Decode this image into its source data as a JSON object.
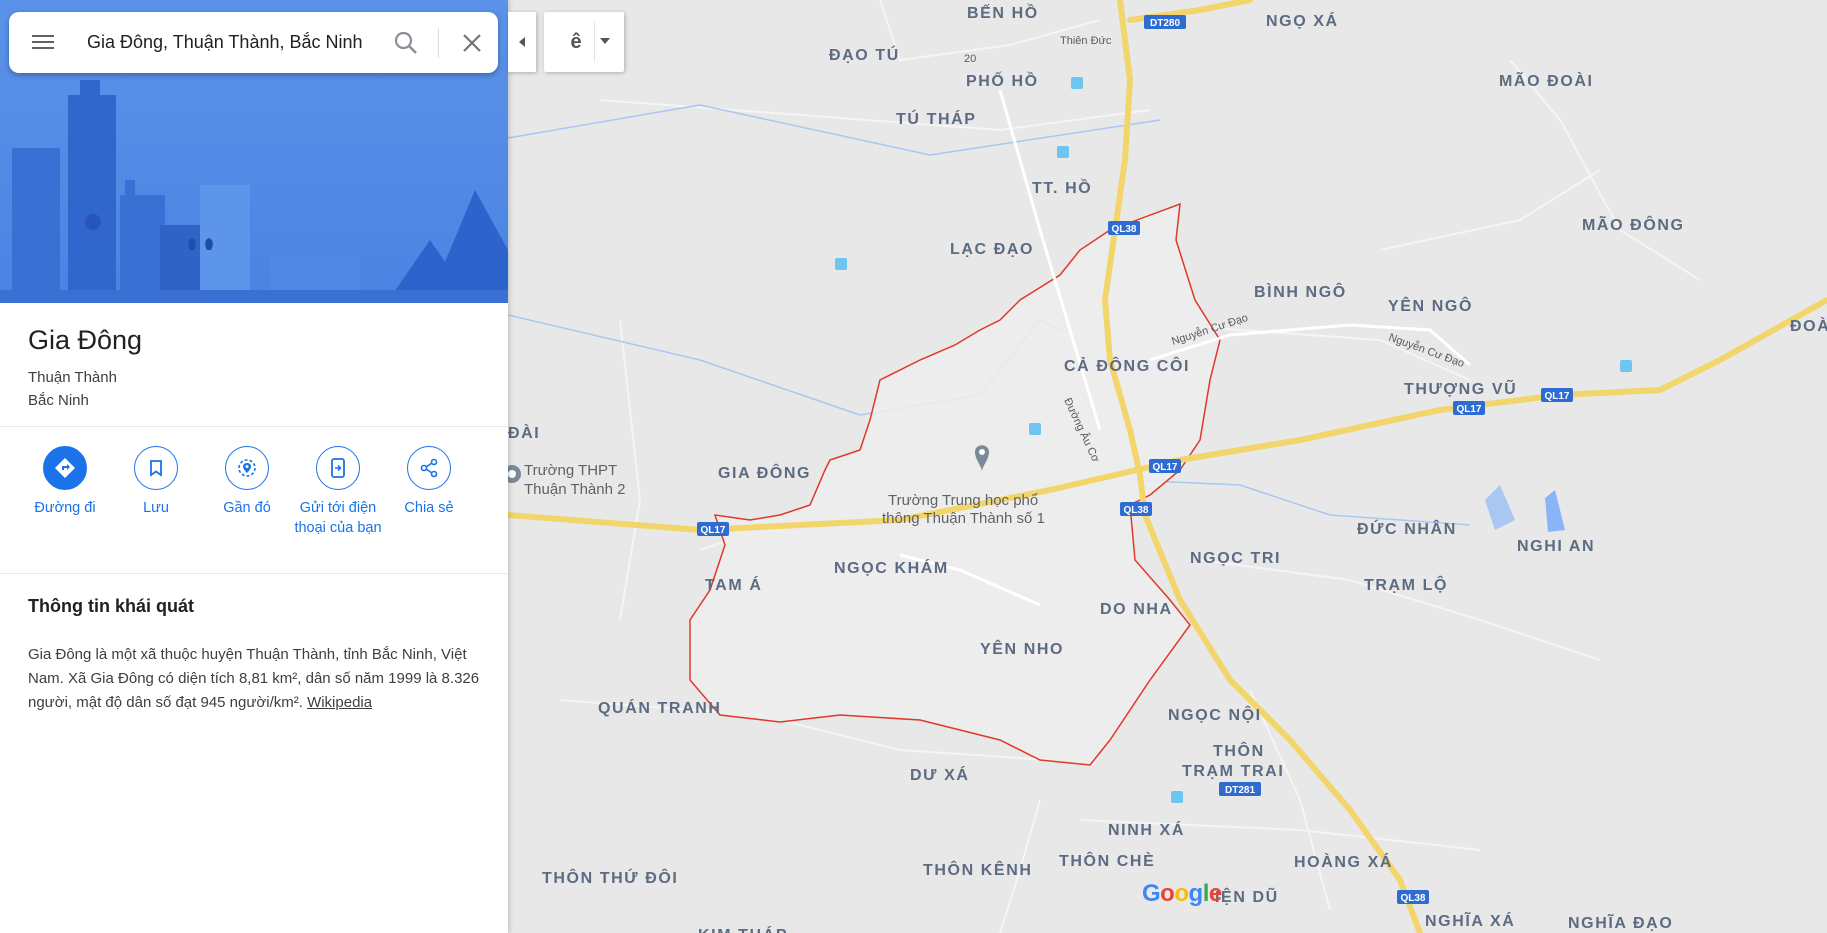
{
  "search": {
    "query": "Gia Đông, Thuận Thành, Bắc Ninh",
    "menu_icon": "menu-icon",
    "search_icon": "search-icon",
    "clear_icon": "close-icon"
  },
  "lang_toggle": {
    "glyph": "ê"
  },
  "place": {
    "name": "Gia Đông",
    "district": "Thuận Thành",
    "province": "Bắc Ninh"
  },
  "actions": [
    {
      "label": "Đường đi",
      "icon": "directions-icon"
    },
    {
      "label": "Lưu",
      "icon": "bookmark-icon"
    },
    {
      "label": "Gần đó",
      "icon": "nearby-icon"
    },
    {
      "label": "Gửi tới điện thoại của bạn",
      "icon": "send-to-phone-icon"
    },
    {
      "label": "Chia sẻ",
      "icon": "share-icon"
    }
  ],
  "overview": {
    "title": "Thông tin khái quát",
    "body": "Gia Đông là một xã thuộc huyện Thuận Thành, tỉnh Bắc Ninh, Việt Nam. Xã Gia Đông có diện tích 8,81 km², dân số năm 1999 là 8.326 người, mật độ dân số đạt 945 người/km². ",
    "link": "Wikipedia"
  },
  "map": {
    "place_labels": [
      "BẾN HỒ",
      "NGỌ XÁ",
      "ĐẠO TÚ",
      "PHỐ HỒ",
      "MÃO ĐOÀI",
      "TÚ THÁP",
      "TT. HỒ",
      "MÃO ĐÔNG",
      "LẠC ĐẠO",
      "BÌNH NGÔ",
      "YÊN NGÔ",
      "CẢ ĐÔNG CÔI",
      "THƯỢNG VŨ",
      "ĐOÀ",
      "ĐÀI",
      "GIA ĐÔNG",
      "ĐỨC NHÂN",
      "NGHI AN",
      "NGỌC KHÁM",
      "NGỌC TRI",
      "TAM Á",
      "TRẠM LỘ",
      "DO NHA",
      "YÊN NHO",
      "QUÁN TRANH",
      "NGỌC NỘI",
      "THÔN",
      "TRẠM TRAI",
      "DƯ XÁ",
      "NINH XÁ",
      "THÔN THỨ ĐÔI",
      "THÔN KÊNH",
      "THÔN CHÈ",
      "HOÀNG XÁ",
      "IỆN DŨ",
      "NGHĨA XÁ",
      "NGHĨA ĐẠO",
      "KIM THÁP"
    ],
    "road_shields": [
      "DT280",
      "QL38",
      "QL17",
      "QL17",
      "QL17",
      "QL38",
      "QL17",
      "DT281",
      "QL38"
    ],
    "street_labels": [
      "Thiên Đức",
      "Nguyễn Cư Đạo",
      "Nguyễn Cư Đạo",
      "Đường Âu Cơ",
      "20"
    ],
    "poi_labels": [
      "Trường THPT",
      "Thuận Thành 2",
      "Trường Trung học phổ",
      "thông Thuận Thành số 1"
    ],
    "logo": "Google"
  },
  "colors": {
    "accent": "#1a73e8",
    "boundary": "#e0382b",
    "highway": "#f2d56b",
    "water": "#8ab4f8"
  }
}
